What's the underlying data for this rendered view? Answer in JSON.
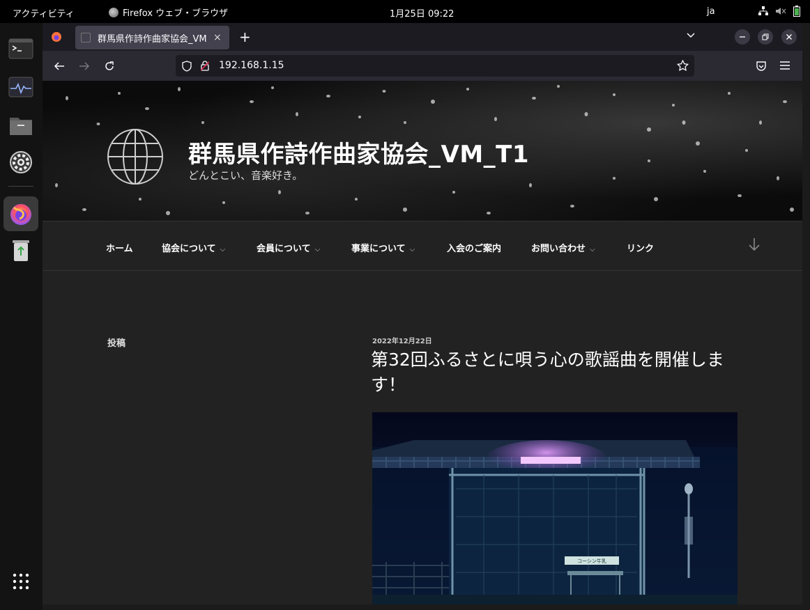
{
  "topbar": {
    "activities": "アクティビティ",
    "app_name": "Firefox ウェブ・ブラウザ",
    "clock": "1月25日  09:22",
    "input_method": "ja"
  },
  "dock": {
    "items": [
      {
        "name": "terminal-icon"
      },
      {
        "name": "system-monitor-icon"
      },
      {
        "name": "files-icon"
      },
      {
        "name": "settings-icon"
      },
      {
        "name": "firefox-icon"
      },
      {
        "name": "trash-icon"
      },
      {
        "name": "app-grid-icon"
      }
    ]
  },
  "browser": {
    "tab_title": "群馬県作詩作曲家協会_VM",
    "tab_close": "×",
    "new_tab": "+",
    "url": "192.168.1.15"
  },
  "site": {
    "title": "群馬県作詩作曲家協会_VM_T1",
    "tagline": "どんとこい、音楽好き。",
    "menu": [
      {
        "label": "ホーム",
        "has_sub": false
      },
      {
        "label": "協会について",
        "has_sub": true
      },
      {
        "label": "会員について",
        "has_sub": true
      },
      {
        "label": "事業について",
        "has_sub": true
      },
      {
        "label": "入会のご案内",
        "has_sub": false
      },
      {
        "label": "お問い合わせ",
        "has_sub": true
      },
      {
        "label": "リンク",
        "has_sub": false
      }
    ],
    "sidebar_title": "投稿",
    "post": {
      "date": "2022年12月22日",
      "title": "第32回ふるさとに唄う心の歌謡曲を開催します！",
      "image_sign_text": "コーシン牛乳"
    }
  },
  "colors": {
    "topbar": "#000000",
    "dock": "#131313",
    "tab_active": "#42414d",
    "navbar": "#2b2a33",
    "page_bg": "#222222"
  }
}
